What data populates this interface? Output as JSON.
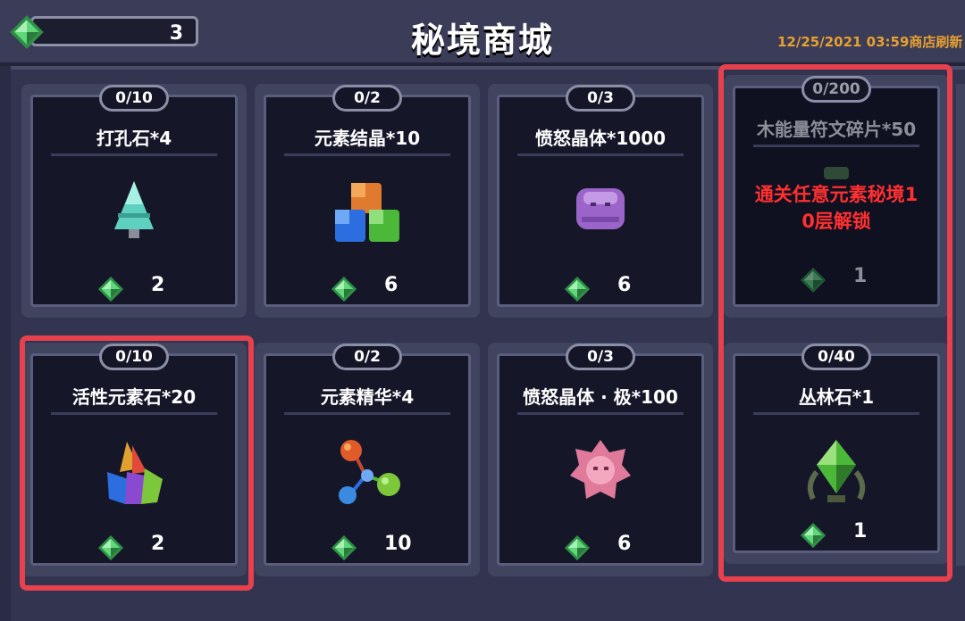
{
  "header": {
    "title": "秘境商城",
    "currency_value": "3",
    "refresh_text": "12/25/2021 03:59商店刷新"
  },
  "items": [
    {
      "limit": "0/10",
      "name": "打孔石*4",
      "price": "2"
    },
    {
      "limit": "0/2",
      "name": "元素结晶*10",
      "price": "6"
    },
    {
      "limit": "0/3",
      "name": "愤怒晶体*1000",
      "price": "6"
    },
    {
      "limit": "0/200",
      "name": "木能量符文碎片*50",
      "price": "1",
      "lock_text_1": "通关任意元素秘境1",
      "lock_text_2": "0层解锁"
    },
    {
      "limit": "0/10",
      "name": "活性元素石*20",
      "price": "2"
    },
    {
      "limit": "0/2",
      "name": "元素精华*4",
      "price": "10"
    },
    {
      "limit": "0/3",
      "name": "愤怒晶体 · 极*100",
      "price": "6"
    },
    {
      "limit": "0/40",
      "name": "丛林石*1",
      "price": "1"
    }
  ],
  "colors": {
    "highlight": "#e8414d",
    "refresh": "#e8a030",
    "lock_text": "#ff3030",
    "gem": "#3fbf5f"
  },
  "icons": [
    "green-gem-icon",
    "drill-stone-icon",
    "element-crystal-icon",
    "rage-crystal-icon",
    "rune-fragment-icon",
    "active-element-stone-icon",
    "element-essence-icon",
    "rage-crystal-extreme-icon",
    "jungle-stone-icon"
  ]
}
